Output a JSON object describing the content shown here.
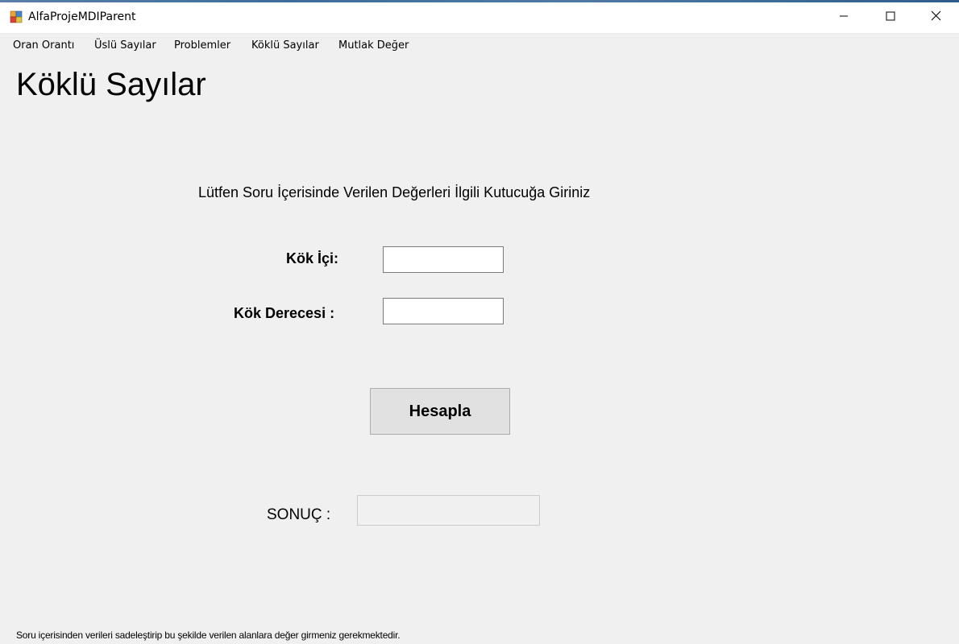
{
  "window": {
    "title": "AlfaProjeMDIParent",
    "controls": [
      "minimize",
      "maximize",
      "close"
    ]
  },
  "menu": {
    "items": [
      {
        "label": "Oran Orantı"
      },
      {
        "label": "Üslü Sayılar"
      },
      {
        "label": "Problemler"
      },
      {
        "label": "Köklü Sayılar"
      },
      {
        "label": "Mutlak Değer"
      }
    ]
  },
  "form": {
    "title": "Köklü Sayılar",
    "instruction": "Lütfen Soru İçerisinde Verilen Değerleri İlgili Kutucuğa Giriniz",
    "kok_ici_label": "Kök İçi:",
    "kok_ici_value": "",
    "kok_derecesi_label": "Kök Derecesi :",
    "kok_derecesi_value": "",
    "calculate_button": "Hesapla",
    "result_label": "SONUÇ :",
    "result_value": "",
    "footer_note": "Soru içerisinden verileri sadeleştirip bu şekilde verilen alanlara değer girmeniz gerekmektedir."
  },
  "colors": {
    "background": "#f0f0f0",
    "titlebar": "#ffffff",
    "button_face": "#e1e1e1",
    "button_border": "#adadad",
    "textbox_border": "#7a7a7a"
  },
  "icons": [
    "app-icon",
    "minimize-icon",
    "maximize-icon",
    "close-icon"
  ]
}
